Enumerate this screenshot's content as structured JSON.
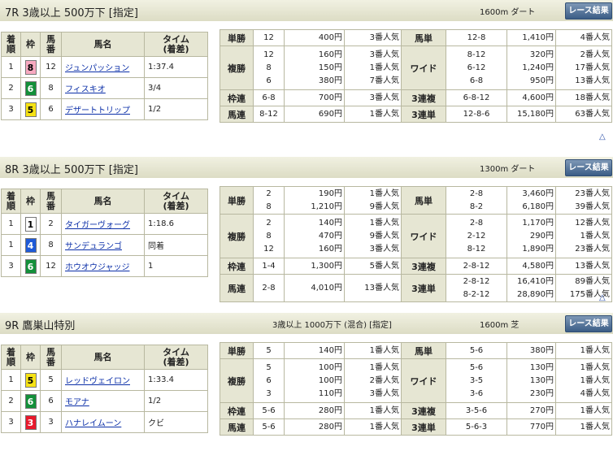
{
  "races": [
    {
      "title": "7R 3歳以上 500万下 [指定]",
      "conditions": "",
      "distance": "1600m ダート",
      "button": "レース結果",
      "headers": {
        "rank": "着\n順",
        "frame": "枠",
        "num": "馬\n番",
        "horse": "馬名",
        "time": "タイム\n(着差)"
      },
      "results": [
        {
          "rank": "1",
          "frame": "8",
          "num": "12",
          "horse": "ジュンパッション",
          "time": "1:37.4"
        },
        {
          "rank": "2",
          "frame": "6",
          "num": "8",
          "horse": "フィスキオ",
          "time": "3/4"
        },
        {
          "rank": "3",
          "frame": "5",
          "num": "6",
          "horse": "デザートトリップ",
          "time": "1/2"
        }
      ],
      "payouts": {
        "tansho": {
          "label": "単勝",
          "nums": [
            "12"
          ],
          "yen": [
            "400円"
          ],
          "pop": [
            "3番人気"
          ]
        },
        "fukusho": {
          "label": "複勝",
          "nums": [
            "12",
            "8",
            "6"
          ],
          "yen": [
            "160円",
            "150円",
            "380円"
          ],
          "pop": [
            "3番人気",
            "1番人気",
            "7番人気"
          ]
        },
        "wakuren": {
          "label": "枠連",
          "nums": [
            "6-8"
          ],
          "yen": [
            "700円"
          ],
          "pop": [
            "3番人気"
          ]
        },
        "umaren": {
          "label": "馬連",
          "nums": [
            "8-12"
          ],
          "yen": [
            "690円"
          ],
          "pop": [
            "1番人気"
          ]
        },
        "umatan": {
          "label": "馬単",
          "nums": [
            "12-8"
          ],
          "yen": [
            "1,410円"
          ],
          "pop": [
            "4番人気"
          ]
        },
        "wide": {
          "label": "ワイド",
          "nums": [
            "8-12",
            "6-12",
            "6-8"
          ],
          "yen": [
            "320円",
            "1,240円",
            "950円"
          ],
          "pop": [
            "2番人気",
            "17番人気",
            "13番人気"
          ]
        },
        "sanrenpuku": {
          "label": "3連複",
          "nums": [
            "6-8-12"
          ],
          "yen": [
            "4,600円"
          ],
          "pop": [
            "18番人気"
          ]
        },
        "sanrentan": {
          "label": "3連単",
          "nums": [
            "12-8-6"
          ],
          "yen": [
            "15,180円"
          ],
          "pop": [
            "63番人気"
          ]
        }
      }
    },
    {
      "title": "8R 3歳以上 500万下 [指定]",
      "conditions": "",
      "distance": "1300m ダート",
      "button": "レース結果",
      "headers": {
        "rank": "着\n順",
        "frame": "枠",
        "num": "馬\n番",
        "horse": "馬名",
        "time": "タイム\n(着差)"
      },
      "results": [
        {
          "rank": "1",
          "frame": "1",
          "num": "2",
          "horse": "タイガーヴォーグ",
          "time": "1:18.6"
        },
        {
          "rank": "1",
          "frame": "4",
          "num": "8",
          "horse": "サンデュランゴ",
          "time": "同着"
        },
        {
          "rank": "3",
          "frame": "6",
          "num": "12",
          "horse": "ホウオウジャッジ",
          "time": "1"
        }
      ],
      "payouts": {
        "tansho": {
          "label": "単勝",
          "nums": [
            "2",
            "8"
          ],
          "yen": [
            "190円",
            "1,210円"
          ],
          "pop": [
            "1番人気",
            "9番人気"
          ]
        },
        "fukusho": {
          "label": "複勝",
          "nums": [
            "2",
            "8",
            "12"
          ],
          "yen": [
            "140円",
            "470円",
            "160円"
          ],
          "pop": [
            "1番人気",
            "9番人気",
            "3番人気"
          ]
        },
        "wakuren": {
          "label": "枠連",
          "nums": [
            "1-4"
          ],
          "yen": [
            "1,300円"
          ],
          "pop": [
            "5番人気"
          ]
        },
        "umaren": {
          "label": "馬連",
          "nums": [
            "2-8"
          ],
          "yen": [
            "4,010円"
          ],
          "pop": [
            "13番人気"
          ]
        },
        "umatan": {
          "label": "馬単",
          "nums": [
            "2-8",
            "8-2"
          ],
          "yen": [
            "3,460円",
            "6,180円"
          ],
          "pop": [
            "23番人気",
            "39番人気"
          ]
        },
        "wide": {
          "label": "ワイド",
          "nums": [
            "2-8",
            "2-12",
            "8-12"
          ],
          "yen": [
            "1,170円",
            "290円",
            "1,890円"
          ],
          "pop": [
            "12番人気",
            "1番人気",
            "23番人気"
          ]
        },
        "sanrenpuku": {
          "label": "3連複",
          "nums": [
            "2-8-12"
          ],
          "yen": [
            "4,580円"
          ],
          "pop": [
            "13番人気"
          ]
        },
        "sanrentan": {
          "label": "3連単",
          "nums": [
            "2-8-12",
            "8-2-12"
          ],
          "yen": [
            "16,410円",
            "28,890円"
          ],
          "pop": [
            "89番人気",
            "175番人気"
          ]
        }
      }
    },
    {
      "title": "9R 鷹巣山特別",
      "conditions": "3歳以上 1000万下 (混合) [指定]",
      "distance": "1600m 芝",
      "button": "レース結果",
      "headers": {
        "rank": "着\n順",
        "frame": "枠",
        "num": "馬\n番",
        "horse": "馬名",
        "time": "タイム\n(着差)"
      },
      "results": [
        {
          "rank": "1",
          "frame": "5",
          "num": "5",
          "horse": "レッドヴェイロン",
          "time": "1:33.4"
        },
        {
          "rank": "2",
          "frame": "6",
          "num": "6",
          "horse": "モアナ",
          "time": "1/2"
        },
        {
          "rank": "3",
          "frame": "3",
          "num": "3",
          "horse": "ハナレイムーン",
          "time": "クビ"
        }
      ],
      "payouts": {
        "tansho": {
          "label": "単勝",
          "nums": [
            "5"
          ],
          "yen": [
            "140円"
          ],
          "pop": [
            "1番人気"
          ]
        },
        "fukusho": {
          "label": "複勝",
          "nums": [
            "5",
            "6",
            "3"
          ],
          "yen": [
            "100円",
            "100円",
            "110円"
          ],
          "pop": [
            "1番人気",
            "2番人気",
            "3番人気"
          ]
        },
        "wakuren": {
          "label": "枠連",
          "nums": [
            "5-6"
          ],
          "yen": [
            "280円"
          ],
          "pop": [
            "1番人気"
          ]
        },
        "umaren": {
          "label": "馬連",
          "nums": [
            "5-6"
          ],
          "yen": [
            "280円"
          ],
          "pop": [
            "1番人気"
          ]
        },
        "umatan": {
          "label": "馬単",
          "nums": [
            "5-6"
          ],
          "yen": [
            "380円"
          ],
          "pop": [
            "1番人気"
          ]
        },
        "wide": {
          "label": "ワイド",
          "nums": [
            "5-6",
            "3-5",
            "3-6"
          ],
          "yen": [
            "130円",
            "130円",
            "230円"
          ],
          "pop": [
            "1番人気",
            "1番人気",
            "4番人気"
          ]
        },
        "sanrenpuku": {
          "label": "3連複",
          "nums": [
            "3-5-6"
          ],
          "yen": [
            "270円"
          ],
          "pop": [
            "1番人気"
          ]
        },
        "sanrentan": {
          "label": "3連単",
          "nums": [
            "5-6-3"
          ],
          "yen": [
            "770円"
          ],
          "pop": [
            "1番人気"
          ]
        }
      }
    }
  ],
  "page_top_icon": "up-triangle-icon",
  "page_top_glyph": "△",
  "frame_colors": {
    "1": {
      "bg": "#ffffff",
      "fg": "#000000"
    },
    "3": {
      "bg": "#e8192c",
      "fg": "#ffffff"
    },
    "4": {
      "bg": "#1e5ad8",
      "fg": "#ffffff"
    },
    "5": {
      "bg": "#f6e214",
      "fg": "#000000"
    },
    "6": {
      "bg": "#13903a",
      "fg": "#ffffff"
    },
    "8": {
      "bg": "#f7a9c0",
      "fg": "#000000"
    }
  }
}
